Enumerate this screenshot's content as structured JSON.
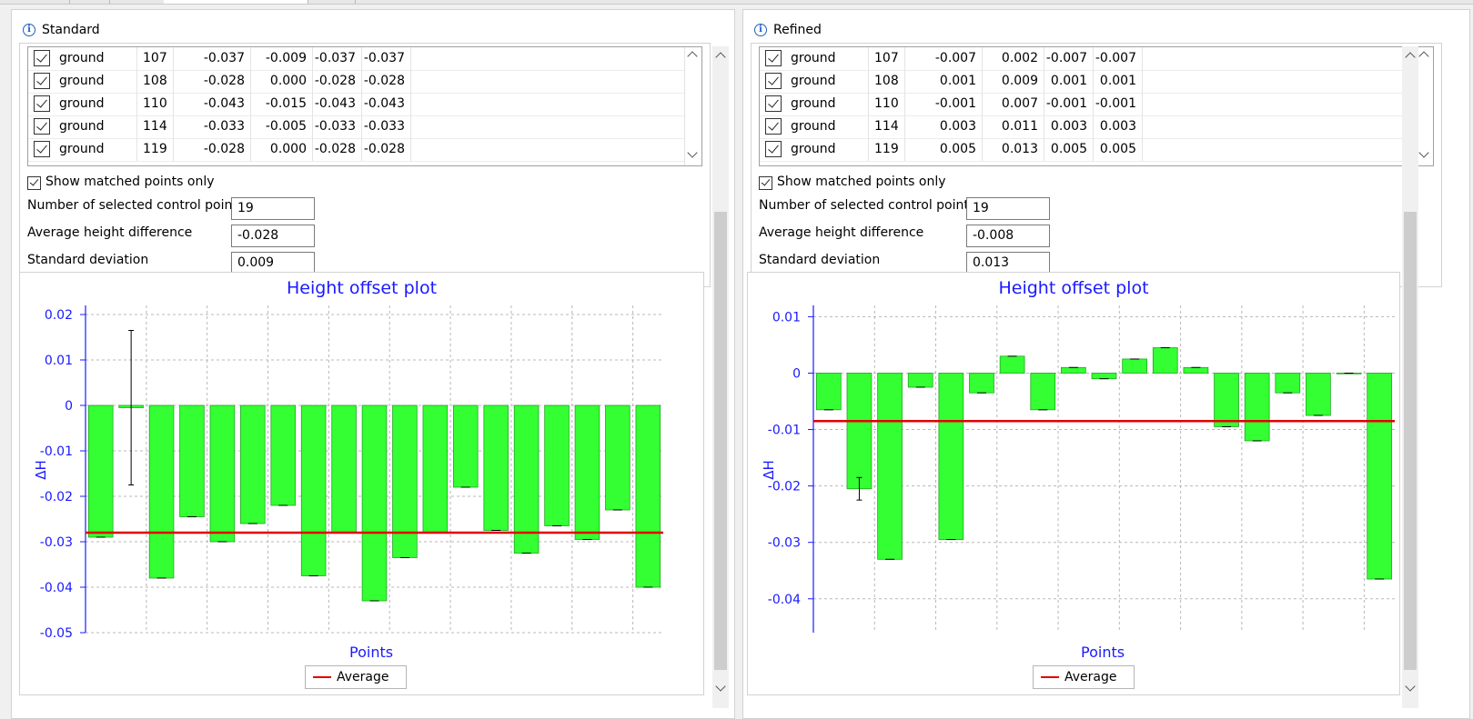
{
  "panels": [
    {
      "title": "Standard",
      "rows": [
        {
          "checked": true,
          "name": "ground",
          "id": "107",
          "c1": "-0.037",
          "c2": "-0.009",
          "c3": "-0.037",
          "c4": "-0.037"
        },
        {
          "checked": true,
          "name": "ground",
          "id": "108",
          "c1": "-0.028",
          "c2": "0.000",
          "c3": "-0.028",
          "c4": "-0.028"
        },
        {
          "checked": true,
          "name": "ground",
          "id": "110",
          "c1": "-0.043",
          "c2": "-0.015",
          "c3": "-0.043",
          "c4": "-0.043"
        },
        {
          "checked": true,
          "name": "ground",
          "id": "114",
          "c1": "-0.033",
          "c2": "-0.005",
          "c3": "-0.033",
          "c4": "-0.033"
        },
        {
          "checked": true,
          "name": "ground",
          "id": "119",
          "c1": "-0.028",
          "c2": "0.000",
          "c3": "-0.028",
          "c4": "-0.028"
        }
      ],
      "show_matched_label": "Show matched points only",
      "num_selected_label": "Number of selected control points",
      "num_selected_value": "19",
      "avg_label": "Average height difference",
      "avg_value": "-0.028",
      "std_label": "Standard deviation",
      "std_value": "0.009"
    },
    {
      "title": "Refined",
      "rows": [
        {
          "checked": true,
          "name": "ground",
          "id": "107",
          "c1": "-0.007",
          "c2": "0.002",
          "c3": "-0.007",
          "c4": "-0.007"
        },
        {
          "checked": true,
          "name": "ground",
          "id": "108",
          "c1": "0.001",
          "c2": "0.009",
          "c3": "0.001",
          "c4": "0.001"
        },
        {
          "checked": true,
          "name": "ground",
          "id": "110",
          "c1": "-0.001",
          "c2": "0.007",
          "c3": "-0.001",
          "c4": "-0.001"
        },
        {
          "checked": true,
          "name": "ground",
          "id": "114",
          "c1": "0.003",
          "c2": "0.011",
          "c3": "0.003",
          "c4": "0.003"
        },
        {
          "checked": true,
          "name": "ground",
          "id": "119",
          "c1": "0.005",
          "c2": "0.013",
          "c3": "0.005",
          "c4": "0.005"
        }
      ],
      "show_matched_label": "Show matched points only",
      "num_selected_label": "Number of selected control points",
      "num_selected_value": "19",
      "avg_label": "Average height difference",
      "avg_value": "-0.008",
      "std_label": "Standard deviation",
      "std_value": "0.013"
    }
  ],
  "chart_data": [
    {
      "type": "bar",
      "title": "Height offset plot",
      "xlabel": "Points",
      "ylabel": "ΔH",
      "ylim": [
        -0.05,
        0.022
      ],
      "yticks": [
        0.02,
        0.01,
        0,
        -0.01,
        -0.02,
        -0.03,
        -0.04,
        -0.05
      ],
      "ytick_labels": [
        "0.02",
        "0.01",
        "0",
        "-0.01",
        "-0.02",
        "-0.03",
        "-0.04",
        "-0.05"
      ],
      "values": [
        -0.029,
        -0.0005,
        -0.038,
        -0.0245,
        -0.03,
        -0.026,
        -0.022,
        -0.0375,
        -0.028,
        -0.043,
        -0.0335,
        -0.028,
        -0.018,
        -0.0275,
        -0.0325,
        -0.0265,
        -0.0295,
        -0.023,
        -0.04
      ],
      "errors": [
        0,
        0.017,
        0,
        0,
        0,
        0,
        0,
        0,
        0,
        0,
        0,
        0,
        0,
        0,
        0,
        0,
        0,
        0,
        0
      ],
      "average": -0.028,
      "legend": [
        "Average"
      ],
      "colors": {
        "bar": "#33ff33",
        "bar_edge": "#1fa81f",
        "average": "#e00000",
        "axis": "#1a1aff"
      },
      "grid": true
    },
    {
      "type": "bar",
      "title": "Height offset plot",
      "xlabel": "Points",
      "ylabel": "ΔH",
      "ylim": [
        -0.046,
        0.012
      ],
      "yticks": [
        0.01,
        0,
        -0.01,
        -0.02,
        -0.03,
        -0.04
      ],
      "ytick_labels": [
        "0.01",
        "0",
        "-0.01",
        "-0.02",
        "-0.03",
        "-0.04"
      ],
      "values": [
        -0.0065,
        -0.0205,
        -0.033,
        -0.0025,
        -0.0295,
        -0.0035,
        0.003,
        -0.0065,
        0.001,
        -0.001,
        0.0025,
        0.0045,
        0.001,
        -0.0095,
        -0.012,
        -0.0035,
        -0.0075,
        0,
        -0.0365
      ],
      "errors": [
        0,
        0.002,
        0,
        0,
        0,
        0,
        0,
        0,
        0,
        0,
        0,
        0,
        0,
        0,
        0,
        0,
        0,
        0,
        0
      ],
      "average": -0.0085,
      "legend": [
        "Average"
      ],
      "colors": {
        "bar": "#33ff33",
        "bar_edge": "#1fa81f",
        "average": "#e00000",
        "axis": "#1a1aff"
      },
      "grid": true
    }
  ]
}
